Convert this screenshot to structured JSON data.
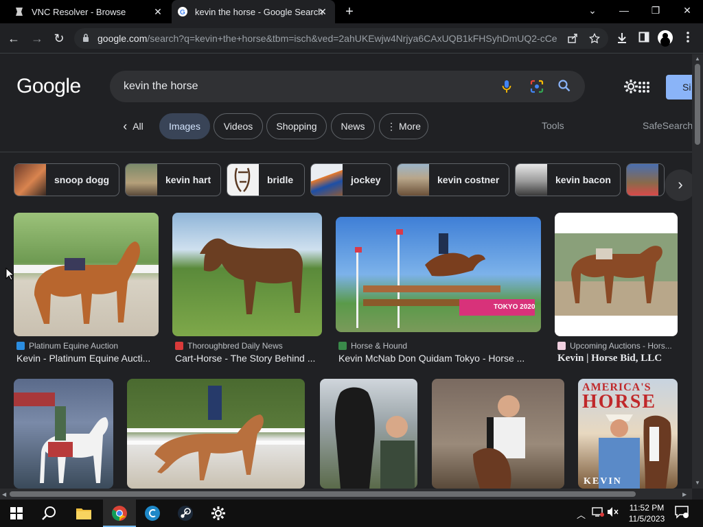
{
  "tabs": [
    {
      "title": "VNC Resolver - Browse",
      "close": "✕"
    },
    {
      "title": "kevin the horse - Google Search",
      "close": "✕"
    }
  ],
  "new_tab": "+",
  "window_controls": {
    "minimize": "—",
    "maximize": "❐",
    "close": "✕",
    "dropdown": "⌄"
  },
  "toolbar": {
    "back": "←",
    "forward": "→",
    "reload": "↻",
    "url_domain": "google.com",
    "url_path": "/search?q=kevin+the+horse&tbm=isch&ved=2ahUKEwjw4Nrjya6CAxUQB1kFHSyhDmUQ2-cCe..."
  },
  "google": {
    "logo": "Google",
    "query": "kevin the horse",
    "signin": "Si"
  },
  "filters": [
    {
      "label": "All",
      "prefix": "‹"
    },
    {
      "label": "Images"
    },
    {
      "label": "Videos"
    },
    {
      "label": "Shopping"
    },
    {
      "label": "News"
    },
    {
      "label": "More",
      "prefix": "⋮"
    }
  ],
  "tools": {
    "tools": "Tools",
    "safesearch": "SafeSearch"
  },
  "related": [
    {
      "label": "snoop dogg"
    },
    {
      "label": "kevin hart"
    },
    {
      "label": "bridle"
    },
    {
      "label": "jockey"
    },
    {
      "label": "kevin costner"
    },
    {
      "label": "kevin bacon"
    }
  ],
  "results": [
    {
      "source": "Platinum Equine Auction",
      "caption": "Kevin - Platinum Equine Aucti..."
    },
    {
      "source": "Thoroughbred Daily News",
      "caption": "Cart-Horse - The Story Behind ..."
    },
    {
      "source": "Horse & Hound",
      "caption": "Kevin McNab Don Quidam Tokyo - Horse ..."
    },
    {
      "source": "Upcoming Auctions - Hors...",
      "caption": "Kevin | Horse Bid, LLC"
    }
  ],
  "image_text": {
    "tokyo": "TOKYO 2020",
    "magazine_top": "AMERICA'S",
    "magazine_mid": "HORSE",
    "magazine_bottom": "KEVIN"
  },
  "taskbar": {
    "time": "11:52 PM",
    "date": "11/5/2023"
  },
  "colors": {
    "accent": "#8ab4f8",
    "chip_active": "#394457",
    "background": "#202124"
  }
}
